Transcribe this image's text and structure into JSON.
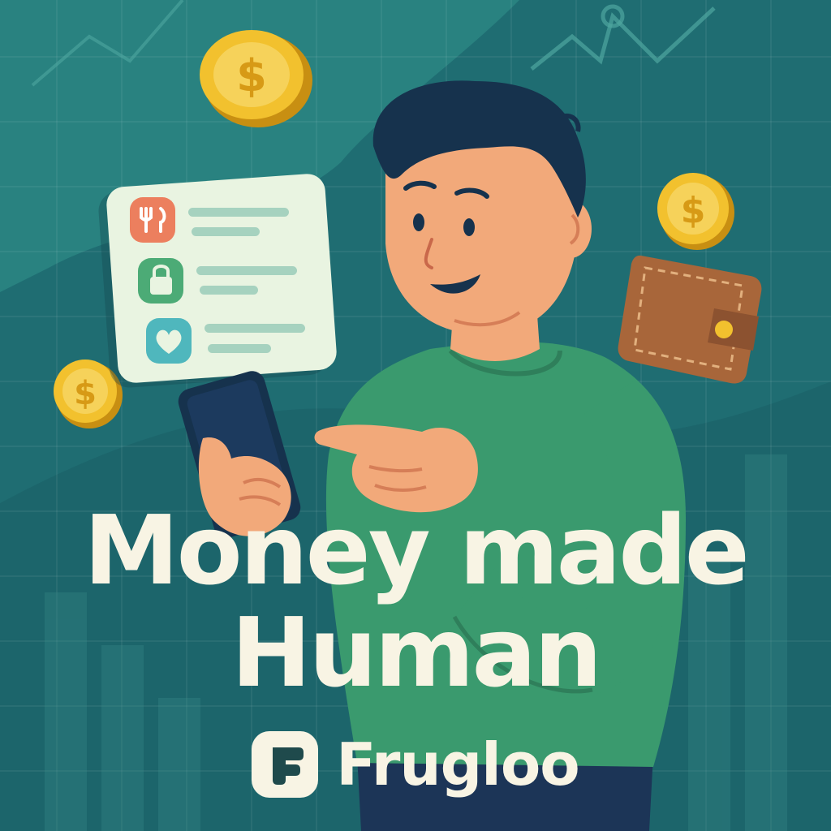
{
  "headline": {
    "line1": "Money made",
    "line2": "Human"
  },
  "brand": {
    "name": "Frugloo",
    "logo_letter": "F"
  },
  "coin": {
    "symbol": "$"
  },
  "icons": [
    "fork-knife-icon",
    "lock-icon",
    "heart-icon",
    "dollar-coin-icon",
    "wallet-icon"
  ],
  "colors": {
    "background": "#1d6f73",
    "accent_text": "#f8f4e4",
    "shirt": "#3a9a6e",
    "coin": "#f2c12e",
    "wallet": "#a8663a"
  }
}
